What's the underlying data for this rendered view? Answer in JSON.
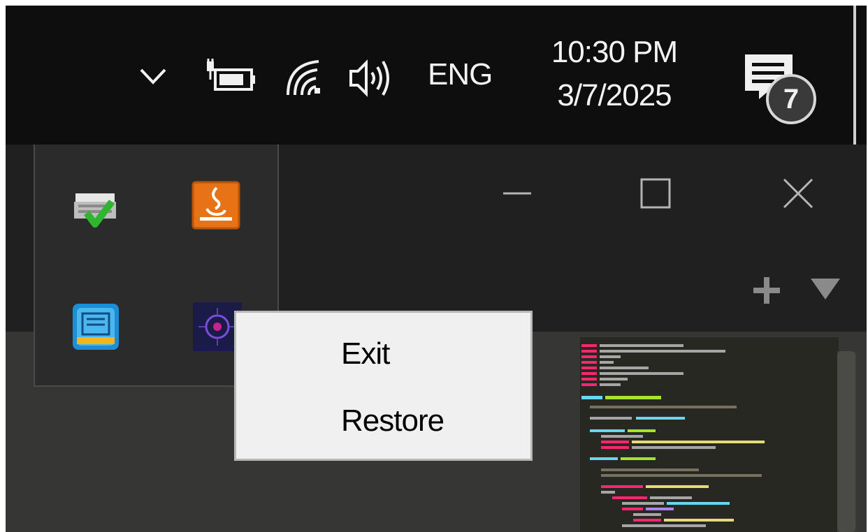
{
  "taskbar": {
    "language": "ENG",
    "time": "10:30 PM",
    "date": "3/7/2025",
    "notification_count": "7",
    "icons": [
      "chevron-up-icon",
      "battery-charging-icon",
      "wifi-icon",
      "volume-icon",
      "action-center-icon"
    ]
  },
  "tray_overflow": {
    "icons": [
      "printer-check-icon",
      "java-icon",
      "intel-graphics-icon",
      "purple-app-icon"
    ]
  },
  "window_controls": {
    "icons": [
      "minimize-icon",
      "maximize-icon",
      "close-icon",
      "add-tab-icon",
      "dropdown-icon"
    ]
  },
  "context_menu": {
    "items": [
      {
        "label": "Exit"
      },
      {
        "label": "Restore"
      }
    ]
  },
  "colors": {
    "taskbar_bg": "#0e0e0e",
    "menu_bg": "#f0f0f0",
    "java_orange": "#e87216",
    "check_green": "#2fb52f"
  }
}
